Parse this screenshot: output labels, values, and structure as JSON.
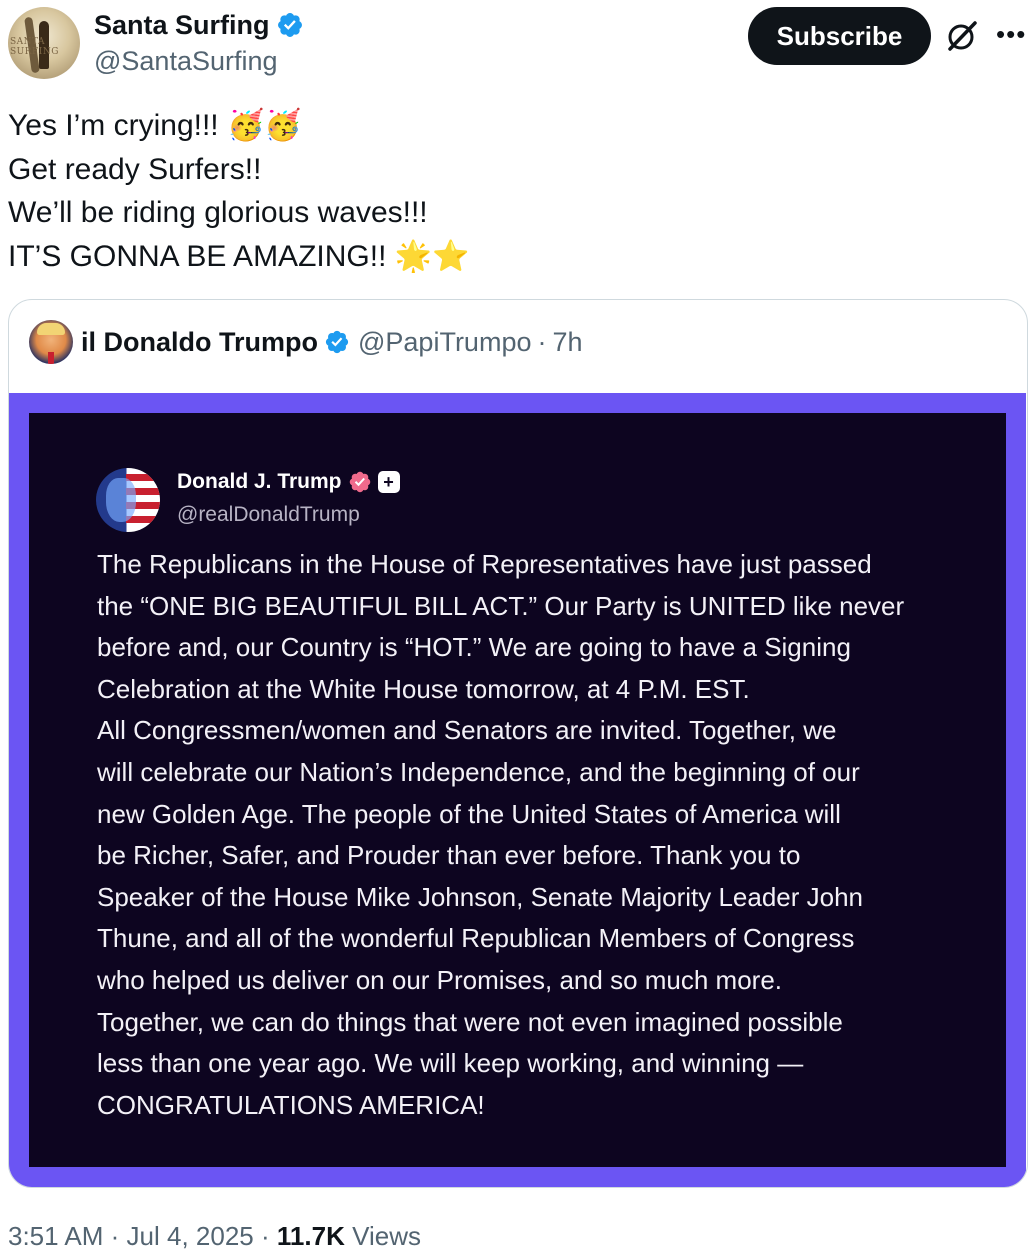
{
  "author": {
    "display_name": "Santa Surfing",
    "handle": "@SantaSurfing",
    "avatar_logo_text": "SANTA SURFING"
  },
  "actions": {
    "subscribe_label": "Subscribe",
    "grok_icon": "grok-icon",
    "more_icon": "more-icon"
  },
  "tweet": {
    "lines": [
      "Yes I’m crying!!! 🥳🥳",
      "Get ready Surfers!!",
      "We’ll be riding glorious waves!!!",
      "IT’S GONNA BE AMAZING!! 🌟⭐"
    ]
  },
  "quote": {
    "display_name": "il Donaldo Trumpo",
    "handle": "@PapiTrumpo",
    "separator": "·",
    "time": "7h",
    "image": {
      "poster_name": "Donald J. Trump",
      "poster_handle": "@realDonaldTrump",
      "plus_badge": "+",
      "body_lines": [
        "The Republicans in the House of Representatives have just passed",
        "the “ONE BIG BEAUTIFUL BILL ACT.” Our Party is UNITED like never",
        "before and, our Country is “HOT.” We are going to have a Signing",
        "Celebration at the White House tomorrow, at 4 P.M. EST.",
        "All Congressmen/women and Senators are invited. Together, we",
        "will celebrate our Nation’s Independence, and the beginning of our",
        "new Golden Age. The people of the United States of America will",
        "be Richer, Safer, and Prouder than ever before. Thank you to",
        "Speaker of the House Mike Johnson, Senate Majority Leader John",
        "Thune, and all of the wonderful Republican Members of Congress",
        "who helped us deliver on our Promises, and so much more.",
        "Together, we can do things that were not even imagined possible",
        "less than one year ago. We will keep working, and winning —",
        "CONGRATULATIONS AMERICA!"
      ]
    }
  },
  "footer": {
    "time": "3:51 AM",
    "separator": "·",
    "date": "Jul 4, 2025",
    "views_count": "11.7K",
    "views_label": "Views"
  },
  "colors": {
    "verified_blue": "#1d9bf0",
    "frame_purple": "#6b55f3",
    "image_background": "#0d0520",
    "truth_badge_pink": "#f06a8c"
  }
}
